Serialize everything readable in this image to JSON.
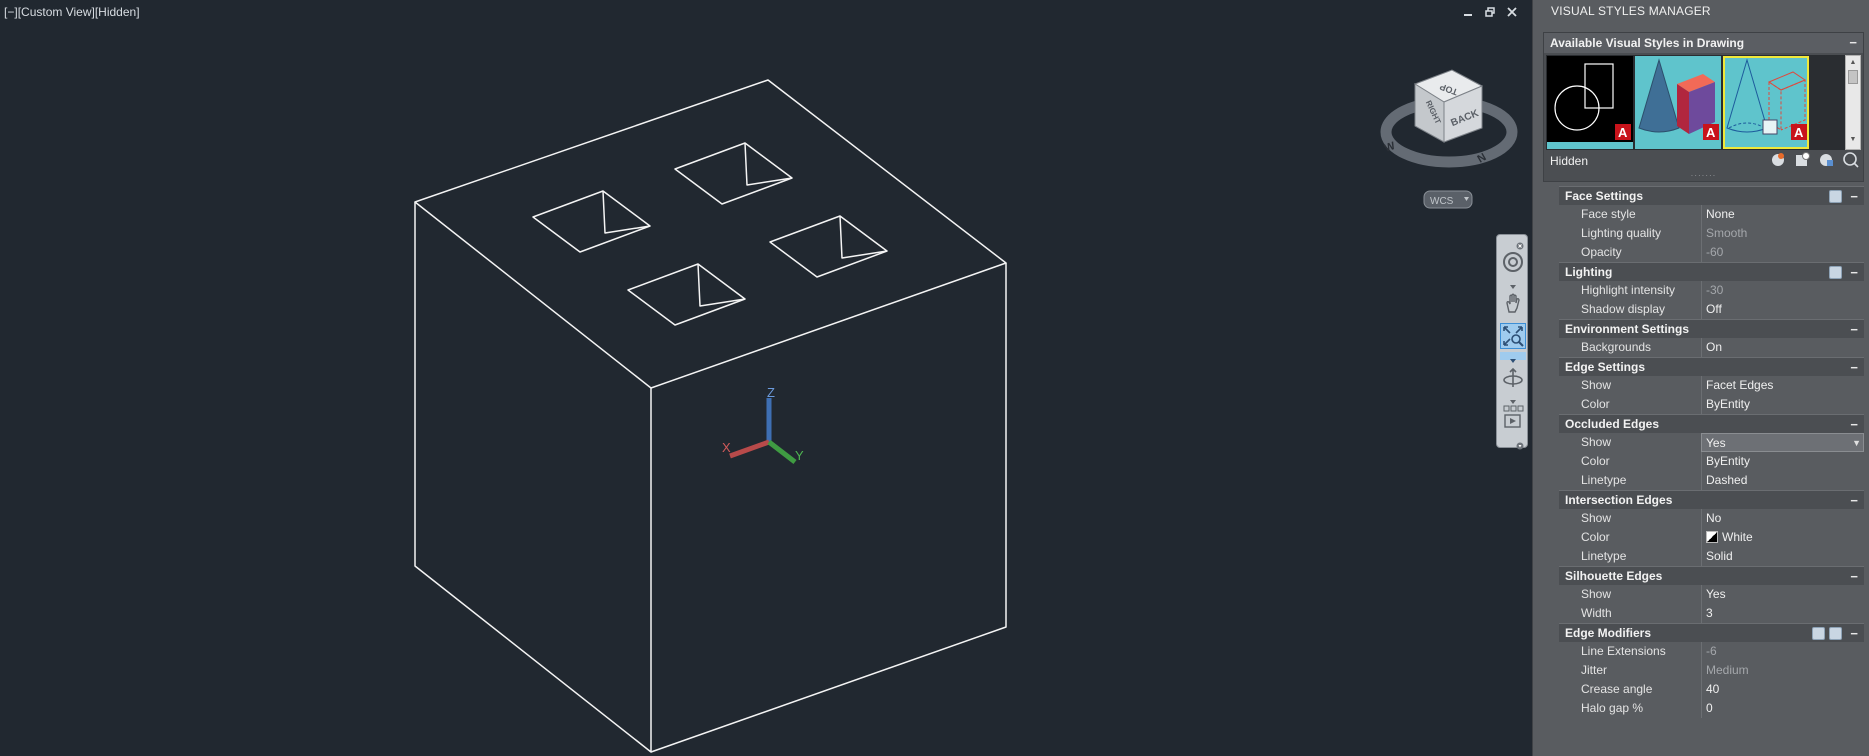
{
  "viewport": {
    "label": "[−][Custom View][Hidden]",
    "label_parts": [
      "[−]",
      "[Custom View]",
      "[Hidden]"
    ],
    "wcs_label": "WCS",
    "viewcube_faces": {
      "top": "TOP",
      "right": "RIGHT",
      "back": "BACK"
    },
    "compass_letters": [
      "E",
      "N",
      "W"
    ],
    "ucs": {
      "x": "X",
      "y": "Y",
      "z": "Z"
    }
  },
  "panel": {
    "title": "VISUAL STYLES MANAGER",
    "available_header": "Available Visual Styles in Drawing",
    "current_style": "Hidden",
    "sections": [
      {
        "title": "Face Settings",
        "icons": 1,
        "rows": [
          {
            "label": "Face style",
            "value": "None"
          },
          {
            "label": "Lighting quality",
            "value": "Smooth",
            "dim": true
          },
          {
            "label": "Opacity",
            "value": "-60",
            "dim": true
          }
        ]
      },
      {
        "title": "Lighting",
        "icons": 1,
        "rows": [
          {
            "label": "Highlight intensity",
            "value": "-30",
            "dim": true
          },
          {
            "label": "Shadow display",
            "value": "Off"
          }
        ]
      },
      {
        "title": "Environment Settings",
        "icons": 0,
        "rows": [
          {
            "label": "Backgrounds",
            "value": "On"
          }
        ]
      },
      {
        "title": "Edge Settings",
        "icons": 0,
        "rows": [
          {
            "label": "Show",
            "value": "Facet Edges"
          },
          {
            "label": "Color",
            "value": "ByEntity"
          }
        ]
      },
      {
        "title": "Occluded Edges",
        "icons": 0,
        "rows": [
          {
            "label": "Show",
            "value": "Yes",
            "select": true
          },
          {
            "label": "Color",
            "value": "ByEntity"
          },
          {
            "label": "Linetype",
            "value": "Dashed"
          }
        ]
      },
      {
        "title": "Intersection Edges",
        "icons": 0,
        "rows": [
          {
            "label": "Show",
            "value": "No"
          },
          {
            "label": "Color",
            "value": "White",
            "swatch": true
          },
          {
            "label": "Linetype",
            "value": "Solid"
          }
        ]
      },
      {
        "title": "Silhouette Edges",
        "icons": 0,
        "rows": [
          {
            "label": "Show",
            "value": "Yes"
          },
          {
            "label": "Width",
            "value": "3"
          }
        ]
      },
      {
        "title": "Edge Modifiers",
        "icons": 2,
        "rows": [
          {
            "label": "Line Extensions",
            "value": "-6",
            "dim": true
          },
          {
            "label": "Jitter",
            "value": "Medium",
            "dim": true
          },
          {
            "label": "Crease angle",
            "value": "40"
          },
          {
            "label": "Halo gap %",
            "value": "0"
          }
        ]
      }
    ]
  }
}
